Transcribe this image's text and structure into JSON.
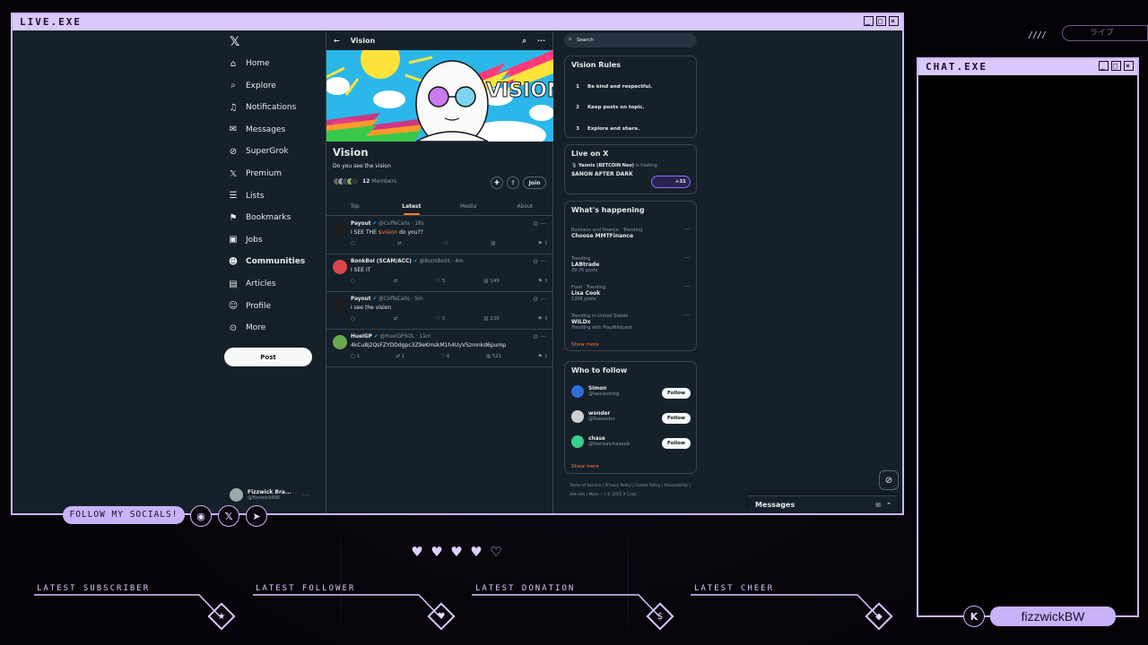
{
  "overlay": {
    "live_title": "LIVE.EXE",
    "chat_title": "CHAT.EXE",
    "jp_label": "ライブ",
    "follow_socials": "FOLLOW MY SOCIALS!",
    "streamer_name": "fizzwickBW",
    "latest": [
      {
        "label": "LATEST SUBSCRIBER",
        "icon": "star-icon"
      },
      {
        "label": "LATEST FOLLOWER",
        "icon": "heart-icon"
      },
      {
        "label": "LATEST DONATION",
        "icon": "dollar-icon"
      },
      {
        "label": "LATEST CHEER",
        "icon": "gem-icon"
      }
    ],
    "accent": "#cdb6f5"
  },
  "x": {
    "nav": [
      {
        "label": "Home",
        "icon": "home-icon"
      },
      {
        "label": "Explore",
        "icon": "search-icon"
      },
      {
        "label": "Notifications",
        "icon": "bell-icon"
      },
      {
        "label": "Messages",
        "icon": "mail-icon"
      },
      {
        "label": "SuperGrok",
        "icon": "grok-icon"
      },
      {
        "label": "Premium",
        "icon": "x-icon"
      },
      {
        "label": "Lists",
        "icon": "list-icon"
      },
      {
        "label": "Bookmarks",
        "icon": "bookmark-icon"
      },
      {
        "label": "Jobs",
        "icon": "briefcase-icon"
      },
      {
        "label": "Communities",
        "icon": "people-icon"
      },
      {
        "label": "Articles",
        "icon": "article-icon"
      },
      {
        "label": "Profile",
        "icon": "person-icon"
      },
      {
        "label": "More",
        "icon": "more-circle-icon"
      }
    ],
    "post_button": "Post",
    "account": {
      "name": "Fizzwick Bra...",
      "handle": "@fizzwickBW"
    },
    "header_title": "Vision",
    "banner_text": "VISION",
    "community": {
      "name": "Vision",
      "description": "Do you see the vision",
      "member_count": "12",
      "members_label": "Members",
      "join": "Join"
    },
    "tabs": [
      "Top",
      "Latest",
      "Media",
      "About"
    ],
    "posts": [
      {
        "name": "Payout",
        "handle": "@CoffeCalls · 18s",
        "text_pre": "I SEE THE ",
        "highlight": "$vision",
        "text_post": " do you??",
        "replies": "",
        "reposts": "",
        "likes": "",
        "views": ""
      },
      {
        "name": "BonkBoi (SCAM/ACC)",
        "handle": "@BonkBoilll · 4m",
        "text_pre": "I SEE IT",
        "highlight": "",
        "text_post": "",
        "replies": "",
        "reposts": "",
        "likes": "5",
        "views": "149"
      },
      {
        "name": "Payout",
        "handle": "@CoffeCalls · 5m",
        "text_pre": "i see the vision",
        "highlight": "",
        "text_post": "",
        "replies": "",
        "reposts": "",
        "likes": "5",
        "views": "230"
      },
      {
        "name": "HuelGP",
        "handle": "@HuelGPSOL · 11m",
        "text_pre": "4kCu8j2QsFZYDDdgpc3Z9eKmskM1h4UyV5zmnkd6pump",
        "highlight": "",
        "text_post": "",
        "replies": "1",
        "reposts": "1",
        "likes": "6",
        "views": "521"
      }
    ],
    "search_placeholder": "Search",
    "rules": {
      "title": "Vision Rules",
      "items": [
        "Be kind and respectful.",
        "Keep posts on topic.",
        "Explore and share."
      ]
    },
    "live": {
      "title": "Live on X",
      "host": "Yaonix (BETCOIN Neo)",
      "hosting": "is hosting",
      "space": "$ANON AFTER DARK",
      "listeners": "+31"
    },
    "happening": {
      "title": "What's happening",
      "items": [
        {
          "context": "Business and finance · Trending",
          "topic": "Choose MMTFinance",
          "posts": ""
        },
        {
          "context": "Trending",
          "topic": "LABtrade",
          "posts": "39.7K posts"
        },
        {
          "context": "Food · Trending",
          "topic": "Lisa Cook",
          "posts": "130K posts"
        },
        {
          "context": "Trending in United States",
          "topic": "WILDx",
          "posts": "Trending with PlayWildcard"
        }
      ],
      "show_more": "Show more"
    },
    "who_to_follow": {
      "title": "Who to follow",
      "items": [
        {
          "name": "Simon",
          "handle": "@lassiecking",
          "color": "#2f6fd6"
        },
        {
          "name": "wonder",
          "handle": "@lbwonder",
          "color": "#cfcfcf"
        },
        {
          "name": "chase",
          "handle": "@theroalchaseeb",
          "color": "#3ccf8e"
        }
      ],
      "follow": "Follow",
      "show_more": "Show more"
    },
    "footer": [
      "Terms of Service",
      "Privacy Policy",
      "Cookie Policy",
      "Accessibility",
      "Ads info",
      "More ···",
      "© 2025 X Corp."
    ],
    "messages": "Messages"
  }
}
